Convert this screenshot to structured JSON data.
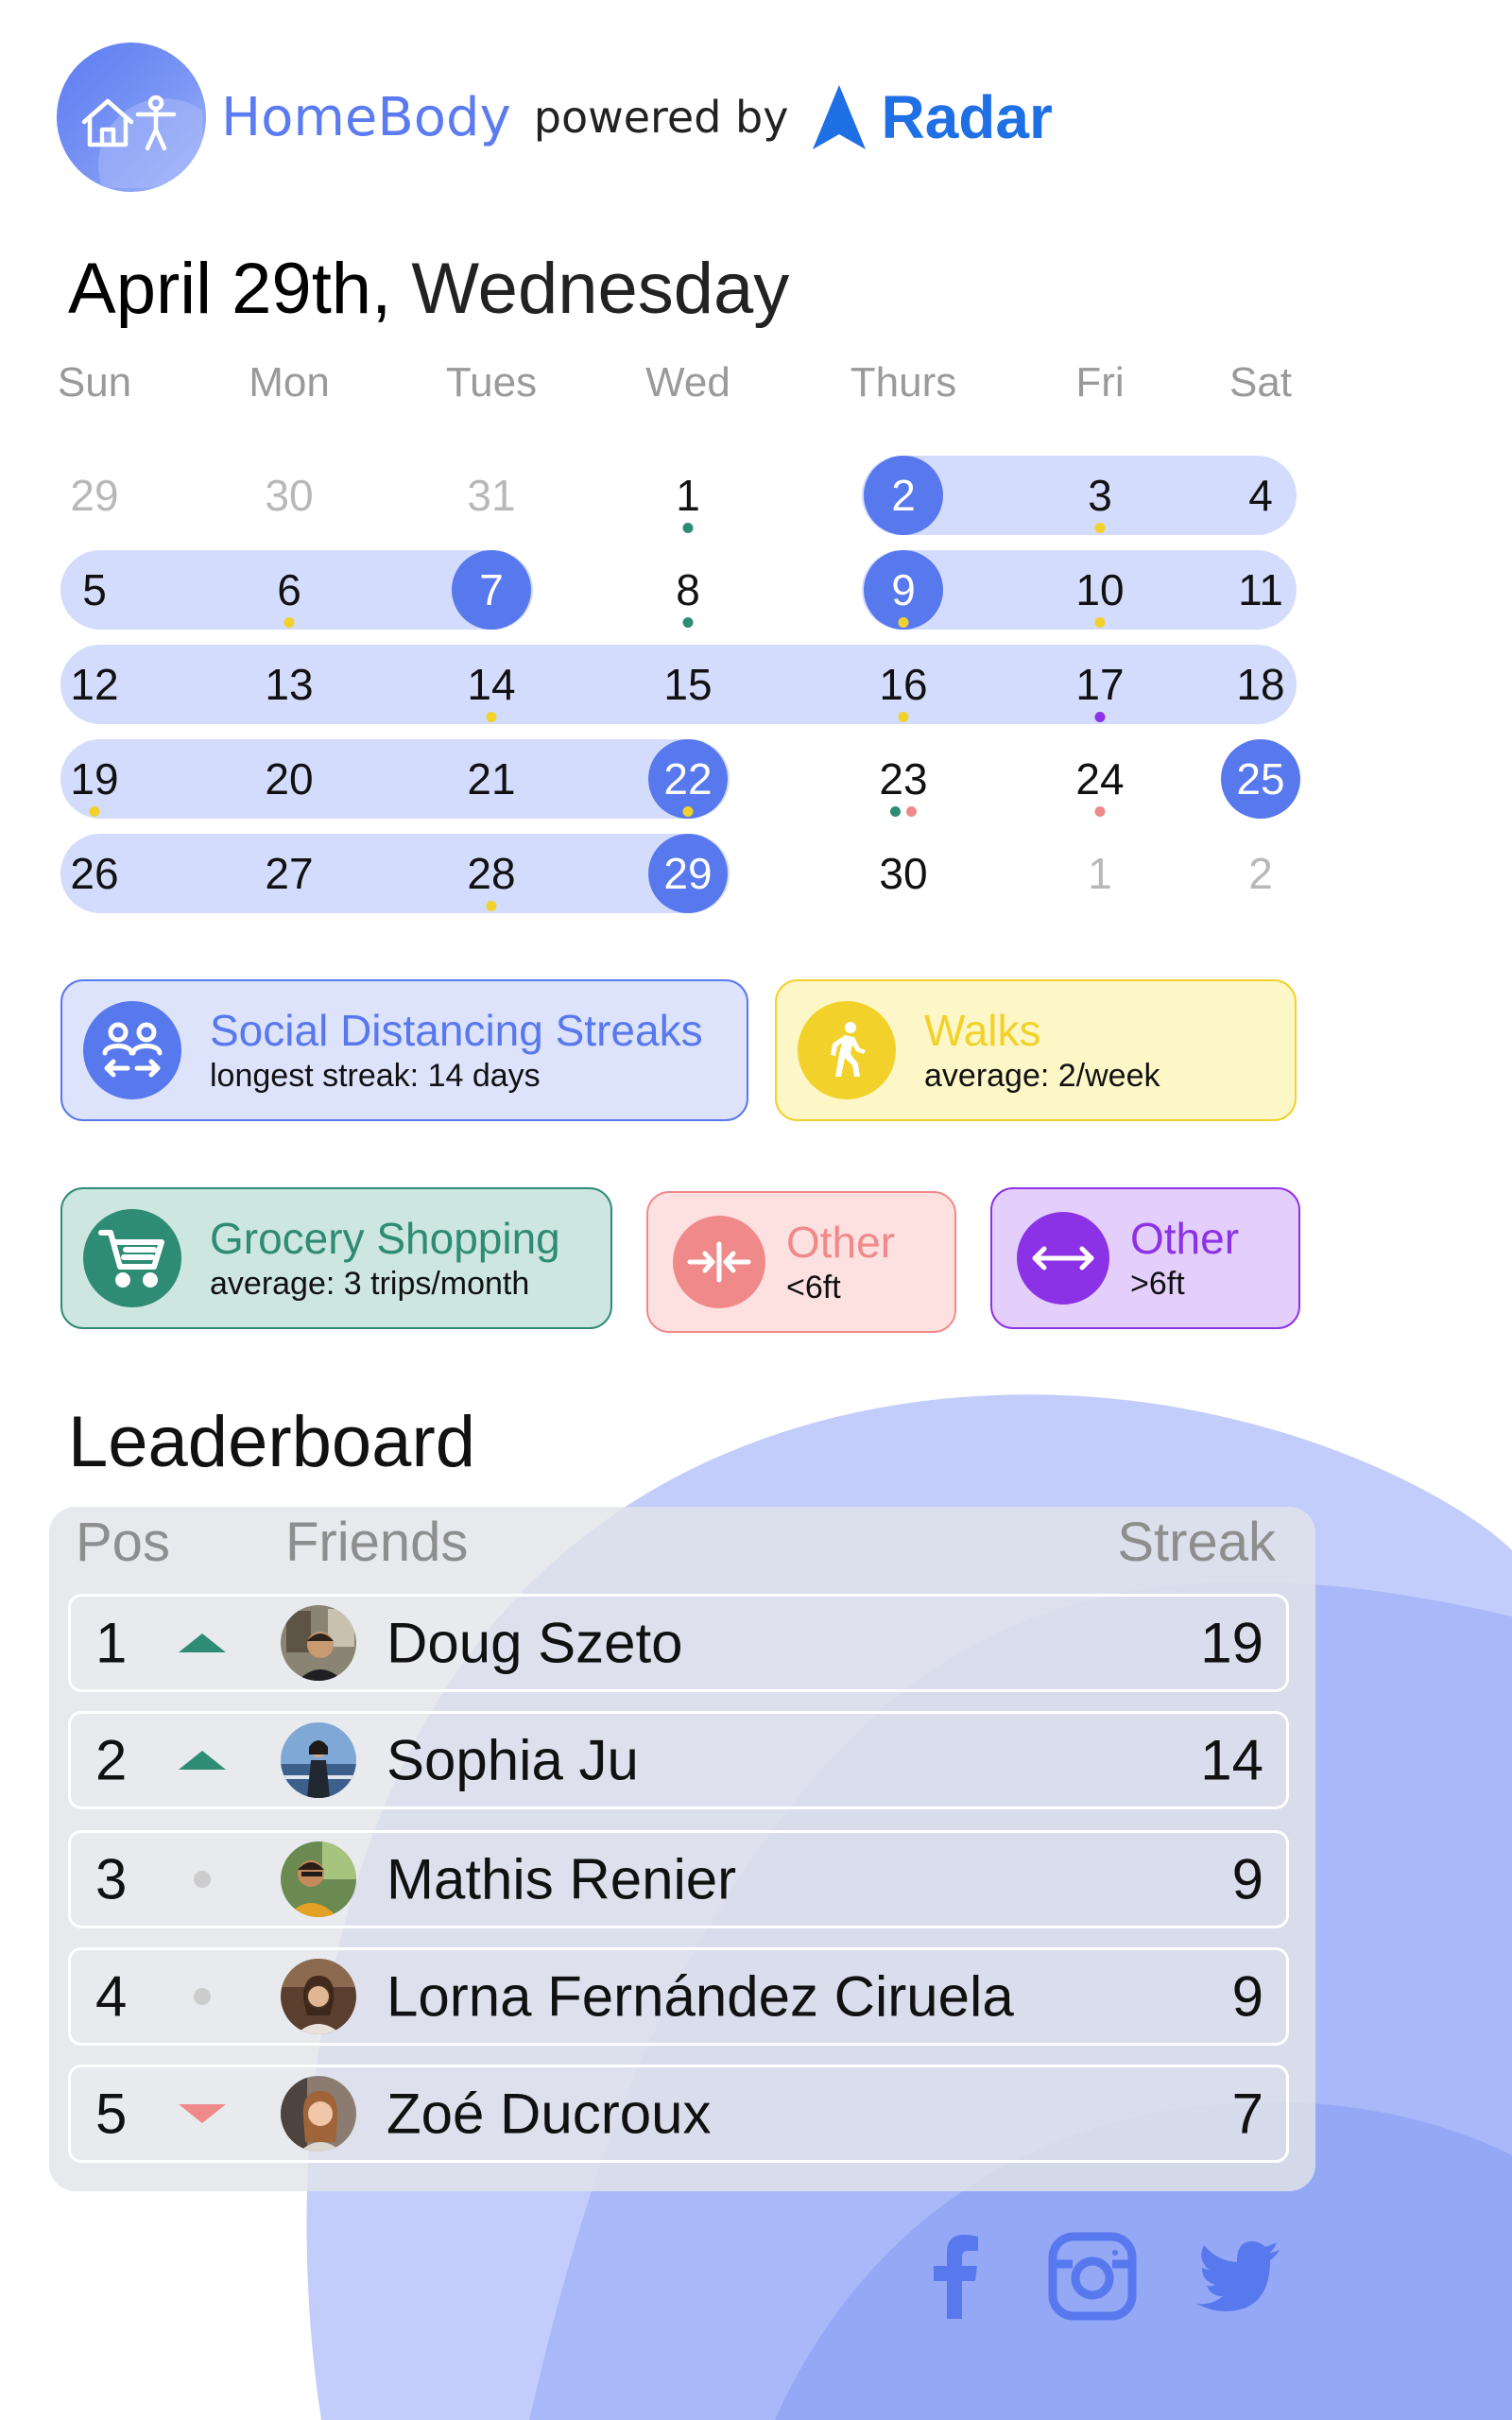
{
  "header": {
    "app_name": "HomeBody",
    "powered_by": "powered by",
    "partner": "Radar",
    "logo_icons": [
      "home-icon",
      "person-icon"
    ]
  },
  "date": {
    "day": "April 29th,",
    "weekday": "Wednesday"
  },
  "calendar": {
    "weekdays": [
      "Sun",
      "Mon",
      "Tues",
      "Wed",
      "Thurs",
      "Fri",
      "Sat"
    ],
    "weeks": [
      [
        {
          "n": "29",
          "dim": true,
          "sel": false,
          "dots": []
        },
        {
          "n": "30",
          "dim": true,
          "sel": false,
          "dots": []
        },
        {
          "n": "31",
          "dim": true,
          "sel": false,
          "dots": []
        },
        {
          "n": "1",
          "dim": false,
          "sel": false,
          "dots": [
            "grocery"
          ]
        },
        {
          "n": "2",
          "dim": false,
          "sel": true,
          "dots": []
        },
        {
          "n": "3",
          "dim": false,
          "sel": false,
          "dots": [
            "walk"
          ]
        },
        {
          "n": "4",
          "dim": false,
          "sel": false,
          "dots": []
        }
      ],
      [
        {
          "n": "5",
          "dim": false,
          "sel": false,
          "dots": []
        },
        {
          "n": "6",
          "dim": false,
          "sel": false,
          "dots": [
            "walk"
          ]
        },
        {
          "n": "7",
          "dim": false,
          "sel": true,
          "dots": []
        },
        {
          "n": "8",
          "dim": false,
          "sel": false,
          "dots": [
            "grocery"
          ]
        },
        {
          "n": "9",
          "dim": false,
          "sel": true,
          "dots": [
            "walk"
          ]
        },
        {
          "n": "10",
          "dim": false,
          "sel": false,
          "dots": [
            "walk"
          ]
        },
        {
          "n": "11",
          "dim": false,
          "sel": false,
          "dots": []
        }
      ],
      [
        {
          "n": "12",
          "dim": false,
          "sel": false,
          "dots": []
        },
        {
          "n": "13",
          "dim": false,
          "sel": false,
          "dots": []
        },
        {
          "n": "14",
          "dim": false,
          "sel": false,
          "dots": [
            "walk"
          ]
        },
        {
          "n": "15",
          "dim": false,
          "sel": false,
          "dots": []
        },
        {
          "n": "16",
          "dim": false,
          "sel": false,
          "dots": [
            "walk"
          ]
        },
        {
          "n": "17",
          "dim": false,
          "sel": false,
          "dots": [
            "far"
          ]
        },
        {
          "n": "18",
          "dim": false,
          "sel": false,
          "dots": []
        }
      ],
      [
        {
          "n": "19",
          "dim": false,
          "sel": false,
          "dots": [
            "walk"
          ]
        },
        {
          "n": "20",
          "dim": false,
          "sel": false,
          "dots": []
        },
        {
          "n": "21",
          "dim": false,
          "sel": false,
          "dots": []
        },
        {
          "n": "22",
          "dim": false,
          "sel": true,
          "dots": [
            "walk"
          ]
        },
        {
          "n": "23",
          "dim": false,
          "sel": false,
          "dots": [
            "grocery",
            "near"
          ]
        },
        {
          "n": "24",
          "dim": false,
          "sel": false,
          "dots": [
            "near"
          ]
        },
        {
          "n": "25",
          "dim": false,
          "sel": true,
          "dots": []
        }
      ],
      [
        {
          "n": "26",
          "dim": false,
          "sel": false,
          "dots": []
        },
        {
          "n": "27",
          "dim": false,
          "sel": false,
          "dots": []
        },
        {
          "n": "28",
          "dim": false,
          "sel": false,
          "dots": [
            "walk"
          ]
        },
        {
          "n": "29",
          "dim": false,
          "sel": true,
          "dots": []
        },
        {
          "n": "30",
          "dim": false,
          "sel": false,
          "dots": []
        },
        {
          "n": "1",
          "dim": true,
          "sel": false,
          "dots": []
        },
        {
          "n": "2",
          "dim": true,
          "sel": false,
          "dots": []
        }
      ]
    ],
    "streak_ranges": [
      {
        "week": 0,
        "from": 4,
        "to": 6
      },
      {
        "week": 1,
        "from": 0,
        "to": 2
      },
      {
        "week": 1,
        "from": 4,
        "to": 6
      },
      {
        "week": 2,
        "from": 0,
        "to": 6
      },
      {
        "week": 3,
        "from": 0,
        "to": 3
      },
      {
        "week": 4,
        "from": 0,
        "to": 3
      }
    ],
    "dot_colors": {
      "walk": "#f2d12a",
      "grocery": "#2e8b74",
      "near": "#f08a8a",
      "far": "#8c32e6"
    }
  },
  "categories": {
    "social": {
      "title": "Social Distancing Streaks",
      "subtitle": "longest streak: 14 days",
      "icon": "social-distance-icon",
      "color": "#5878ee",
      "bg": "#dde3fb"
    },
    "walks": {
      "title": "Walks",
      "subtitle": "average: 2/week",
      "icon": "walking-icon",
      "color": "#f2d12a",
      "bg": "#fdf7c8"
    },
    "grocery": {
      "title": "Grocery Shopping",
      "subtitle": "average: 3 trips/month",
      "icon": "cart-icon",
      "color": "#2e8b74",
      "bg": "#cde6df"
    },
    "other_near": {
      "title": "Other",
      "subtitle": "<6ft",
      "icon": "arrows-inward-icon",
      "color": "#f08a8a",
      "bg": "#fde0e0"
    },
    "other_far": {
      "title": "Other",
      "subtitle": ">6ft",
      "icon": "arrows-outward-icon",
      "color": "#8c32e6",
      "bg": "#e4cefb"
    }
  },
  "leaderboard": {
    "title": "Leaderboard",
    "columns": {
      "pos": "Pos",
      "friends": "Friends",
      "streak": "Streak"
    },
    "rows": [
      {
        "pos": "1",
        "trend": "up",
        "name": "Doug Szeto",
        "streak": "19"
      },
      {
        "pos": "2",
        "trend": "up",
        "name": "Sophia Ju",
        "streak": "14"
      },
      {
        "pos": "3",
        "trend": "same",
        "name": "Mathis Renier",
        "streak": "9"
      },
      {
        "pos": "4",
        "trend": "same",
        "name": "Lorna Fernández Ciruela",
        "streak": "9"
      },
      {
        "pos": "5",
        "trend": "down",
        "name": "Zoé Ducroux",
        "streak": "7"
      }
    ]
  },
  "social_links": [
    "facebook-icon",
    "instagram-icon",
    "twitter-icon"
  ]
}
